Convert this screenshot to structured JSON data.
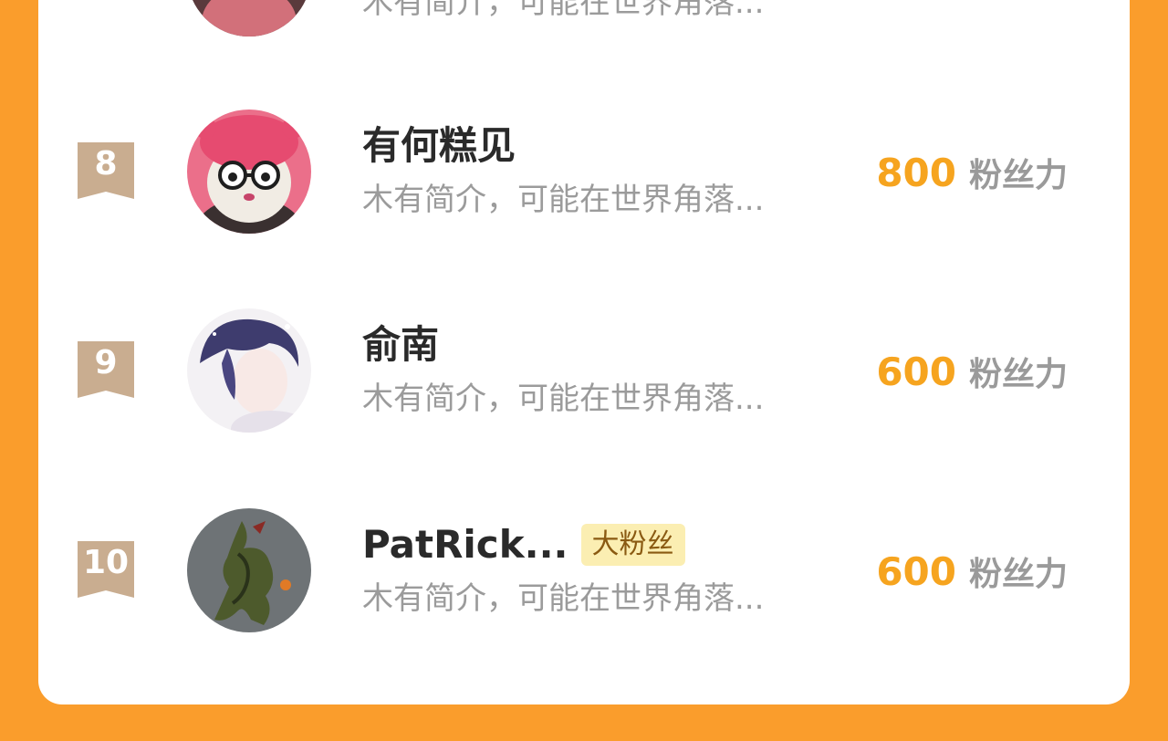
{
  "colors": {
    "page_background": "#fa9d2c",
    "card_background": "#ffffff",
    "rank_flag": "#c9ad90",
    "score": "#f6a41f",
    "unit": "#9a9a9a",
    "badge_background": "#fbeeb2"
  },
  "partial_row": {
    "bio": "木有简介，可能在世界角落..."
  },
  "rows": [
    {
      "rank": "8",
      "name": "有何糕见",
      "badge": "",
      "bio": "木有简介，可能在世界角落...",
      "score": "800",
      "unit": "粉丝力"
    },
    {
      "rank": "9",
      "name": "俞南",
      "badge": "",
      "bio": "木有简介，可能在世界角落...",
      "score": "600",
      "unit": "粉丝力"
    },
    {
      "rank": "10",
      "name": "PatRick...",
      "badge": "大粉丝",
      "bio": "木有简介，可能在世界角落...",
      "score": "600",
      "unit": "粉丝力"
    }
  ]
}
